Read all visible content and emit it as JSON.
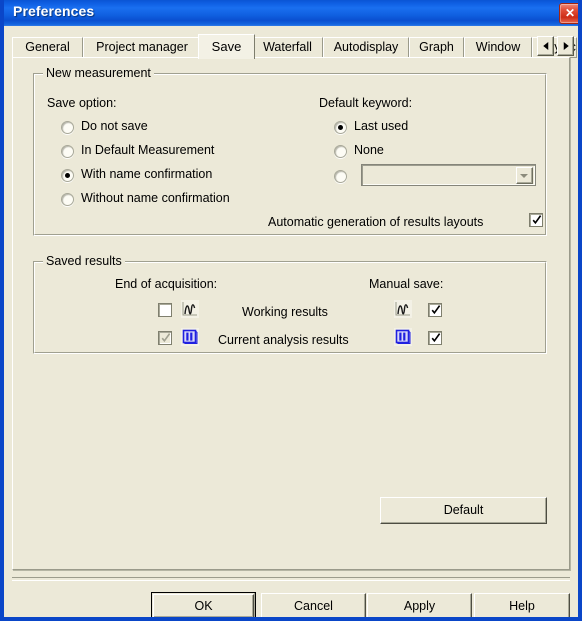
{
  "window": {
    "title": "Preferences",
    "close_label": "✕",
    "close_icon": "close-icon"
  },
  "tabs": {
    "items": [
      {
        "label": "General",
        "selected": false
      },
      {
        "label": "Project manager",
        "selected": false
      },
      {
        "label": "Save",
        "selected": true
      },
      {
        "label": "Waterfall",
        "selected": false
      },
      {
        "label": "Autodisplay",
        "selected": false
      },
      {
        "label": "Graph",
        "selected": false
      },
      {
        "label": "Window",
        "selected": false
      },
      {
        "label": "Physic",
        "selected": false
      }
    ],
    "scroll_left_icon": "chevron-left-icon",
    "scroll_right_icon": "chevron-right-icon"
  },
  "new_measurement": {
    "title": "New measurement",
    "save_option_label": "Save option:",
    "save_options": [
      {
        "label": "Do not save",
        "checked": false
      },
      {
        "label": "In Default Measurement",
        "checked": false
      },
      {
        "label": "With name confirmation",
        "checked": true
      },
      {
        "label": "Without name confirmation",
        "checked": false
      }
    ],
    "default_keyword_label": "Default keyword:",
    "keyword_options": [
      {
        "label": "Last used",
        "checked": true
      },
      {
        "label": "None",
        "checked": false
      }
    ],
    "keyword_custom": {
      "label": "",
      "checked": false,
      "combo_value": "",
      "combo_disabled": true
    },
    "auto_layouts": {
      "label": "Automatic generation of results layouts",
      "checked": true
    }
  },
  "saved_results": {
    "title": "Saved results",
    "col_end_label": "End of acquisition:",
    "col_manual_label": "Manual save:",
    "rows": [
      {
        "name": "Working results",
        "icon": "working-results-icon",
        "end_checked": false,
        "end_disabled": false,
        "manual_checked": true,
        "manual_disabled": false
      },
      {
        "name": "Current analysis results",
        "icon": "analysis-results-icon",
        "end_checked": true,
        "end_disabled": true,
        "manual_checked": true,
        "manual_disabled": false
      }
    ]
  },
  "buttons": {
    "default": "Default",
    "ok": "OK",
    "cancel": "Cancel",
    "apply": "Apply",
    "help": "Help"
  },
  "colors": {
    "window_face": "#ECE9D8",
    "titlebar_blue": "#0A55D4",
    "frame_blue": "#0A46C8",
    "close_red": "#CD2D16",
    "icon_blue": "#2020E0",
    "text": "#000000"
  }
}
